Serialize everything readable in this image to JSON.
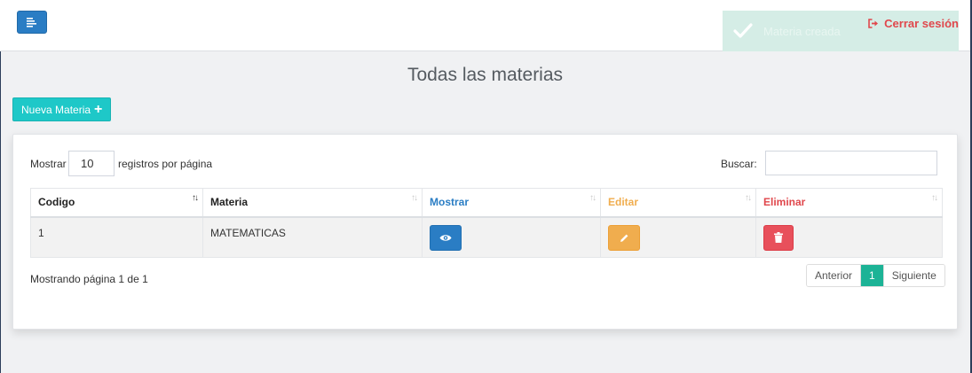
{
  "navbar": {
    "toast_text": "Materia creada",
    "logout_label": "Cerrar sesión"
  },
  "page": {
    "title": "Todas las materias",
    "new_button_label": "Nueva Materia",
    "new_button_icon": "plus-icon"
  },
  "table_controls": {
    "show_label": "Mostrar",
    "page_length": "10",
    "page_length_suffix": "registros por página",
    "search_label": "Buscar:",
    "search_value": ""
  },
  "table": {
    "columns": [
      "Codigo",
      "Materia",
      "Mostrar",
      "Editar",
      "Eliminar"
    ],
    "rows": [
      {
        "codigo": "1",
        "materia": "MATEMATICAS"
      }
    ]
  },
  "footer": {
    "info": "Mostrando página 1 de 1",
    "prev_label": "Anterior",
    "current_page": "1",
    "next_label": "Siguiente"
  },
  "colors": {
    "primary": "#2a7dc4",
    "info": "#1ec8c8",
    "warning": "#f0ad4e",
    "danger": "#e8505b",
    "success_page": "#1cb396",
    "toast_bg": "#d5ede6"
  }
}
